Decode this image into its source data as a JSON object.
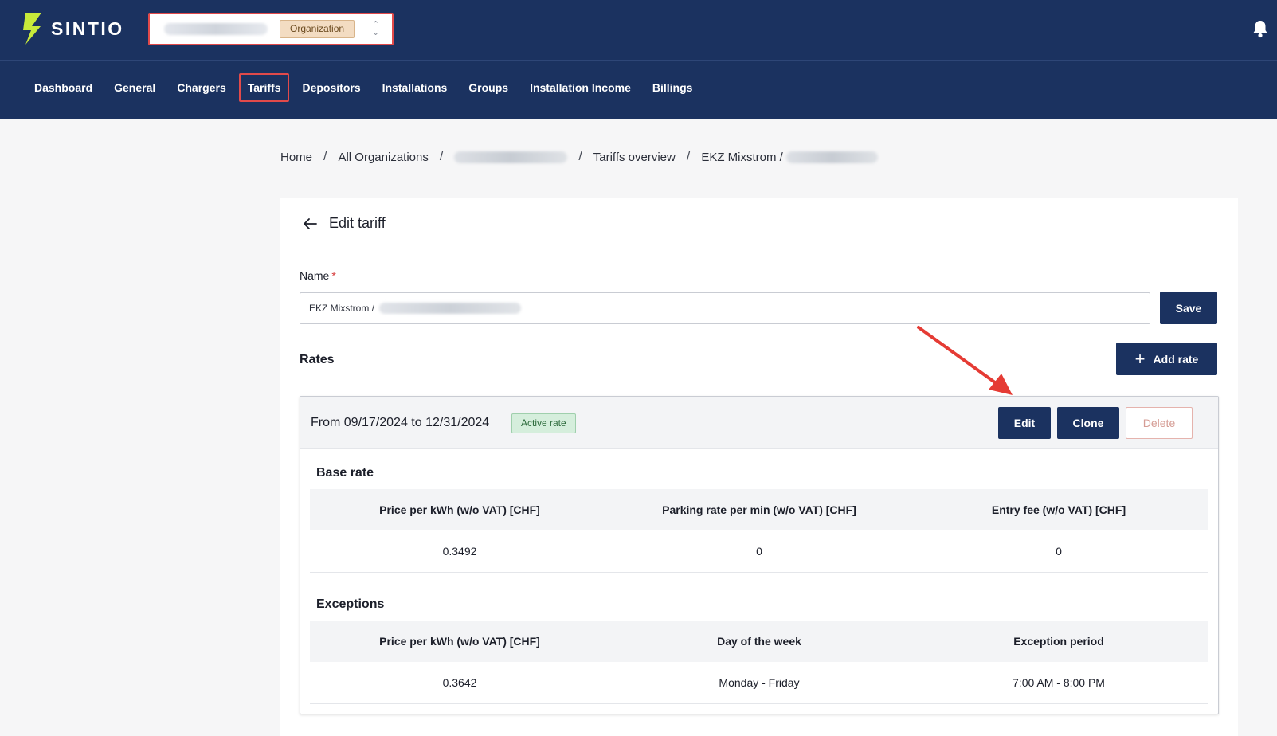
{
  "brand": {
    "name": "SINTIO",
    "accent": "#c8ea3a",
    "primary": "#1b3260"
  },
  "org_switcher": {
    "badge": "Organization"
  },
  "nav": [
    {
      "label": "Dashboard"
    },
    {
      "label": "General"
    },
    {
      "label": "Chargers"
    },
    {
      "label": "Tariffs",
      "active": true
    },
    {
      "label": "Depositors"
    },
    {
      "label": "Installations"
    },
    {
      "label": "Groups"
    },
    {
      "label": "Installation Income"
    },
    {
      "label": "Billings"
    }
  ],
  "breadcrumb": {
    "home": "Home",
    "all_orgs": "All Organizations",
    "tariffs_overview": "Tariffs overview",
    "current": "EKZ Mixstrom /"
  },
  "page": {
    "title": "Edit tariff"
  },
  "form": {
    "name_label": "Name",
    "required_mark": "*",
    "name_value": "EKZ Mixstrom /",
    "save_label": "Save"
  },
  "rates": {
    "label": "Rates",
    "add_label": "Add rate",
    "items": [
      {
        "period": "From 09/17/2024 to 12/31/2024",
        "status": "Active rate",
        "edit_label": "Edit",
        "clone_label": "Clone",
        "delete_label": "Delete",
        "base_rate": {
          "title": "Base rate",
          "headers": [
            "Price per kWh (w/o VAT) [CHF]",
            "Parking rate per min (w/o VAT) [CHF]",
            "Entry fee (w/o VAT) [CHF]"
          ],
          "values": [
            "0.3492",
            "0",
            "0"
          ]
        },
        "exceptions": {
          "title": "Exceptions",
          "headers": [
            "Price per kWh (w/o VAT) [CHF]",
            "Day of the week",
            "Exception period"
          ],
          "values": [
            "0.3642",
            "Monday - Friday",
            "7:00 AM - 8:00 PM"
          ]
        }
      }
    ]
  }
}
